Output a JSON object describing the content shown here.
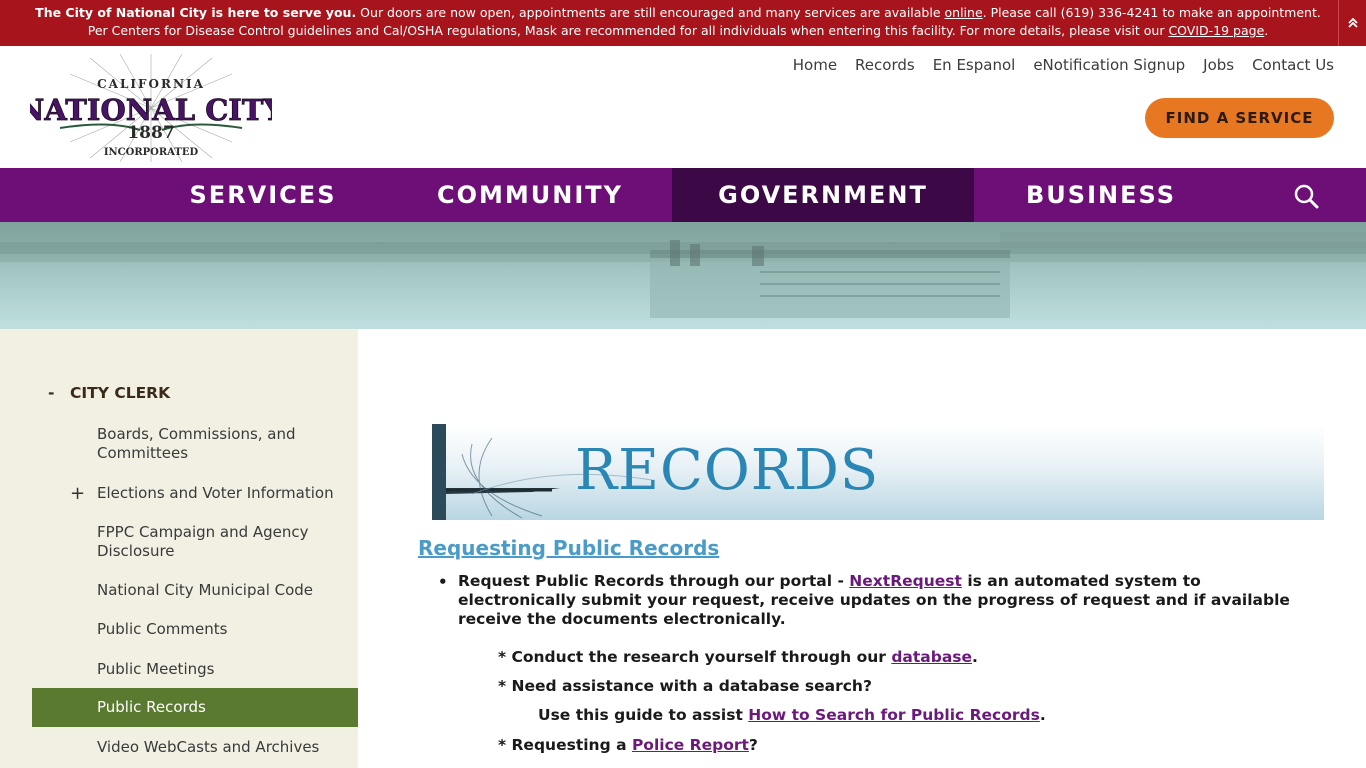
{
  "alert": {
    "bold": "The City of National City is here to serve you.",
    "text1": " Our doors are now open, appointments are still encouraged and many services are available ",
    "link1": "online",
    "text2": ". Please call (619) 336-4241 to make an appointment. Per Centers for Disease Control guidelines and Cal/OSHA regulations, Mask are recommended for all individuals when entering this facility. For more details, please visit our ",
    "link2": "COVID-19 page",
    "text3": "."
  },
  "logo": {
    "top": "CALIFORNIA",
    "main": "NATIONAL CITY",
    "year": "1887",
    "bottom": "INCORPORATED"
  },
  "utility_nav": [
    "Home",
    "Records",
    "En Espanol",
    "eNotification Signup",
    "Jobs",
    "Contact Us"
  ],
  "find_service": "FIND A SERVICE",
  "main_nav": [
    "SERVICES",
    "COMMUNITY",
    "GOVERNMENT",
    "BUSINESS"
  ],
  "colors": {
    "nav_bg": "#6e0f78",
    "nav_active": "#3c0846",
    "alert_bg": "#a8141b",
    "cta": "#e87722",
    "sidebar_active": "#5a7a30"
  },
  "sidebar": {
    "expand_symbol": "-",
    "heading": "CITY CLERK",
    "plus_symbol": "+",
    "items": [
      "Boards, Commissions, and Committees",
      "Elections and Voter Information",
      "FPPC Campaign and Agency Disclosure",
      "National City Municipal Code",
      "Public Comments",
      "Public Meetings",
      "Public Records",
      "Video WebCasts and Archives"
    ]
  },
  "content": {
    "banner_title": "RECORDS",
    "heading": "Requesting Public Records",
    "bullet_pre": "Request Public Records through our portal - ",
    "bullet_link": "NextRequest",
    "bullet_post": " is an automated system to electronically submit your request, receive updates on the progress of request and if available receive the documents electronically.",
    "line1_pre": "* Conduct the research yourself through our ",
    "line1_link": "database",
    "line1_post": ".",
    "line2": "* Need assistance with a database search?",
    "line3_pre": "Use this guide to assist ",
    "line3_link": "How to Search for Public  Records",
    "line3_post": ".",
    "line4_pre": "*  Requesting a ",
    "line4_link": "Police Report",
    "line4_post": "?"
  }
}
